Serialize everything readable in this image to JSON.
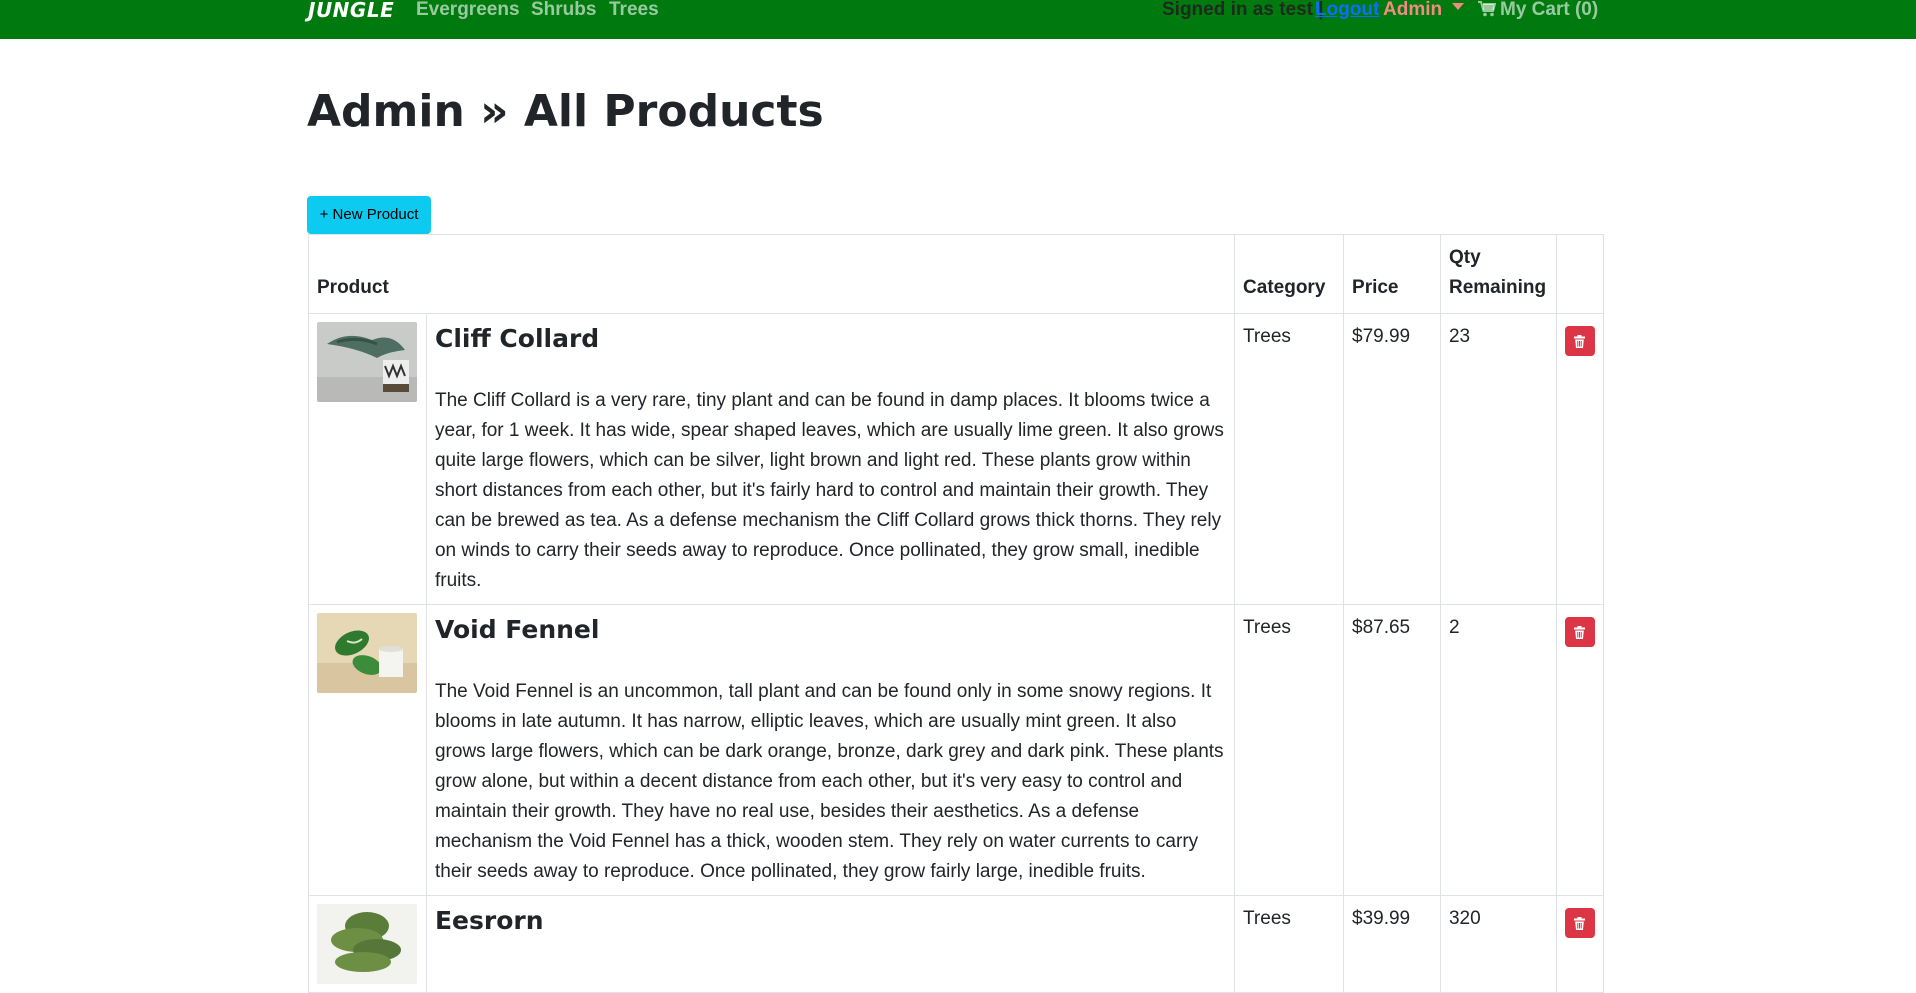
{
  "nav": {
    "brand": "JUNGLE",
    "links": [
      "Evergreens",
      "Shrubs",
      "Trees"
    ],
    "signed_in": "Signed in as test |",
    "logout": "Logout",
    "admin": "Admin",
    "cart": "My Cart (0)"
  },
  "page": {
    "title": "Admin » All Products",
    "new_button": "+ New Product"
  },
  "table": {
    "headers": {
      "product": "Product",
      "category": "Category",
      "price": "Price",
      "qty": "Qty Remaining"
    },
    "rows": [
      {
        "name": "Cliff Collard",
        "description": "The Cliff Collard is a very rare, tiny plant and can be found in damp places. It blooms twice a year, for 1 week. It has wide, spear shaped leaves, which are usually lime green. It also grows quite large flowers, which can be silver, light brown and light red. These plants grow within short distances from each other, but it's fairly hard to control and maintain their growth. They can be brewed as tea. As a defense mechanism the Cliff Collard grows thick thorns. They rely on winds to carry their seeds away to reproduce. Once pollinated, they grow small, inedible fruits.",
        "category": "Trees",
        "price": "$79.99",
        "qty": "23"
      },
      {
        "name": "Void Fennel",
        "description": "The Void Fennel is an uncommon, tall plant and can be found only in some snowy regions. It blooms in late autumn. It has narrow, elliptic leaves, which are usually mint green. It also grows large flowers, which can be dark orange, bronze, dark grey and dark pink. These plants grow alone, but within a decent distance from each other, but it's very easy to control and maintain their growth. They have no real use, besides their aesthetics. As a defense mechanism the Void Fennel has a thick, wooden stem. They rely on water currents to carry their seeds away to reproduce. Once pollinated, they grow fairly large, inedible fruits.",
        "category": "Trees",
        "price": "$87.65",
        "qty": "2"
      },
      {
        "name": "Eesrorn",
        "description": "",
        "category": "Trees",
        "price": "$39.99",
        "qty": "320"
      }
    ]
  },
  "colors": {
    "navbar": "#007a0f",
    "new_button": "#0dcaf0",
    "delete_button": "#dc3545",
    "logout": "#0d6efd",
    "admin": "#f28b82"
  },
  "icons": {
    "cart": "cart-icon",
    "delete": "trash-icon",
    "dropdown": "caret-down-icon"
  }
}
